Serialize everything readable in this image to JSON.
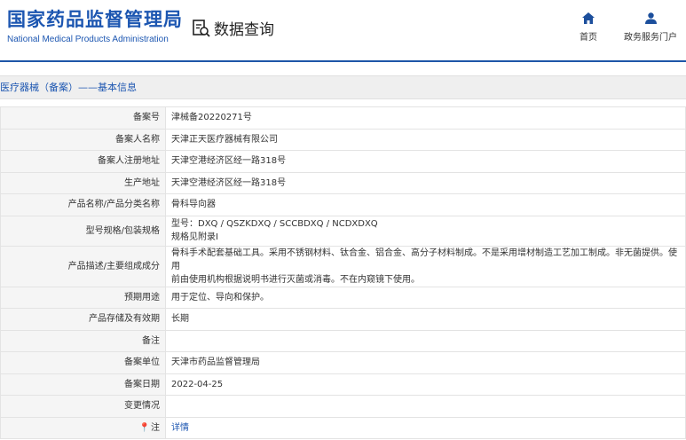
{
  "header": {
    "logo_cn": "国家药品监督管理局",
    "logo_en": "National Medical Products Administration",
    "query_title": "数据查询",
    "nav": {
      "home": "首页",
      "service": "政务服务门户"
    }
  },
  "section": {
    "title": "医疗器械（备案）——基本信息"
  },
  "info": {
    "record_no": {
      "label": "备案号",
      "value": "津械备20220271号"
    },
    "applicant": {
      "label": "备案人名称",
      "value": "天津正天医疗器械有限公司"
    },
    "applicant_address": {
      "label": "备案人注册地址",
      "value": "天津空港经济区经一路318号"
    },
    "production_address": {
      "label": "生产地址",
      "value": "天津空港经济区经一路318号"
    },
    "product_name": {
      "label": "产品名称/产品分类名称",
      "value": "骨科导向器"
    },
    "model_spec": {
      "label": "型号规格/包装规格",
      "line1": "型号：DXQ / QSZKDXQ / SCCBDXQ / NCDXDXQ",
      "line2": "规格见附录I"
    },
    "description": {
      "label": "产品描述/主要组成成分",
      "line1": "骨科手术配套基础工具。采用不锈钢材料、钛合金、铝合金、高分子材料制成。不是采用增材制造工艺加工制成。非无菌提供。使用",
      "line2": "前由使用机构根据说明书进行灭菌或消毒。不在内窥镜下使用。"
    },
    "intended_use": {
      "label": "预期用途",
      "value": "用于定位、导向和保护。"
    },
    "storage": {
      "label": "产品存储及有效期",
      "value": "长期"
    },
    "remark": {
      "label": "备注",
      "value": ""
    },
    "record_unit": {
      "label": "备案单位",
      "value": "天津市药品监督管理局"
    },
    "record_date": {
      "label": "备案日期",
      "value": "2022-04-25"
    },
    "change": {
      "label": "变更情况",
      "value": ""
    },
    "note": {
      "label": "注",
      "link": "详情"
    }
  },
  "colors": {
    "brand_blue": "#1c56b1",
    "label_bg": "#f5f5f5",
    "section_bg": "#efefef",
    "border": "#e3e3e3"
  }
}
